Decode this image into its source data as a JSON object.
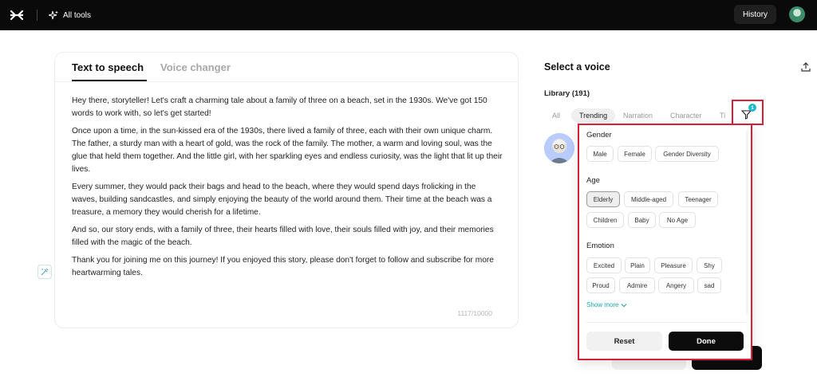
{
  "header": {
    "logo_icon": "capcut-logo-icon",
    "all_tools_icon": "sparkle-icon",
    "all_tools_label": "All tools",
    "history_label": "History"
  },
  "editor": {
    "tabs": [
      {
        "label": "Text to speech",
        "active": true
      },
      {
        "label": "Voice changer",
        "active": false
      }
    ],
    "paragraphs": [
      "Hey there, storyteller! Let's craft a charming tale about a family of three on a beach, set in the 1930s. We've got 150 words to work with, so let's get started!",
      "Once upon a time, in the sun-kissed era of the 1930s, there lived a family of three, each with their own unique charm. The father, a sturdy man with a heart of gold, was the rock of the family. The mother, a warm and loving soul, was the glue that held them together. And the little girl, with her sparkling eyes and endless curiosity, was the light that lit up their lives.",
      "Every summer, they would pack their bags and head to the beach, where they would spend days frolicking in the waves, building sandcastles, and simply enjoying the beauty of the world around them. Their time at the beach was a treasure, a memory they would cherish for a lifetime.",
      "And so, our story ends, with a family of three, their hearts filled with love, their souls filled with joy, and their memories filled with the magic of the beach.",
      "Thank you for joining me on this journey! If you enjoyed this story, please don't forget to follow and subscribe for more heartwarming tales."
    ],
    "char_count": "1117/10000",
    "ai_icon": "ai-rewrite-icon"
  },
  "voice_panel": {
    "title": "Select a voice",
    "library_label": "Library (191)",
    "tabs": [
      {
        "label": "All",
        "active": false
      },
      {
        "label": "Trending",
        "active": true
      },
      {
        "label": "Narration",
        "active": false
      },
      {
        "label": "Character",
        "active": false
      },
      {
        "label": "Ti",
        "active": false
      }
    ],
    "filter_badge": "1",
    "upload_icon": "upload-icon"
  },
  "filter": {
    "gender": {
      "title": "Gender",
      "options": [
        {
          "label": "Male",
          "selected": false
        },
        {
          "label": "Female",
          "selected": false
        },
        {
          "label": "Gender Diversity",
          "selected": false
        }
      ]
    },
    "age": {
      "title": "Age",
      "options": [
        {
          "label": "Elderly",
          "selected": true
        },
        {
          "label": "Middle-aged",
          "selected": false
        },
        {
          "label": "Teenager",
          "selected": false
        },
        {
          "label": "Children",
          "selected": false
        },
        {
          "label": "Baby",
          "selected": false
        },
        {
          "label": "No Age",
          "selected": false
        }
      ]
    },
    "emotion": {
      "title": "Emotion",
      "options": [
        {
          "label": "Excited",
          "selected": false
        },
        {
          "label": "Plain",
          "selected": false
        },
        {
          "label": "Pleasure",
          "selected": false
        },
        {
          "label": "Shy",
          "selected": false
        },
        {
          "label": "Proud",
          "selected": false
        },
        {
          "label": "Admire",
          "selected": false
        },
        {
          "label": "Angery",
          "selected": false
        },
        {
          "label": "sad",
          "selected": false
        }
      ]
    },
    "show_more_label": "Show more",
    "reset_label": "Reset",
    "done_label": "Done"
  },
  "colors": {
    "highlight": "#d71f3a",
    "accent": "#1fb7c9",
    "topbar": "#0a0a0a"
  }
}
